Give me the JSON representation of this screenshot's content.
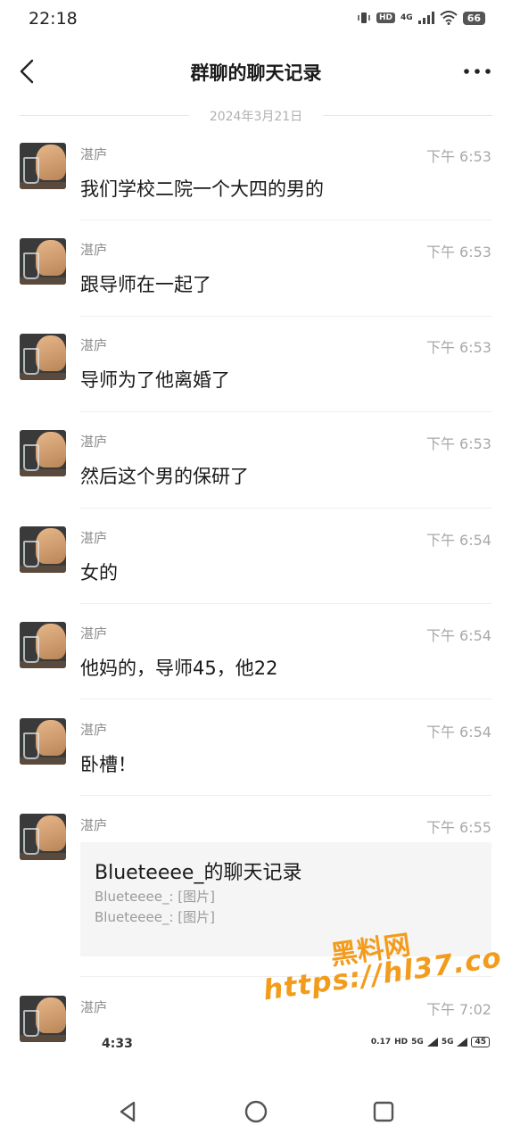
{
  "status_bar": {
    "time": "22:18",
    "hd": "HD",
    "network": "4G",
    "battery": "66"
  },
  "header": {
    "title": "群聊的聊天记录"
  },
  "date_separator": "2024年3月21日",
  "messages": [
    {
      "sender": "湛庐",
      "time": "下午 6:53",
      "text": "我们学校二院一个大四的男的"
    },
    {
      "sender": "湛庐",
      "time": "下午 6:53",
      "text": "跟导师在一起了"
    },
    {
      "sender": "湛庐",
      "time": "下午 6:53",
      "text": "导师为了他离婚了"
    },
    {
      "sender": "湛庐",
      "time": "下午 6:53",
      "text": "然后这个男的保研了"
    },
    {
      "sender": "湛庐",
      "time": "下午 6:54",
      "text": "女的"
    },
    {
      "sender": "湛庐",
      "time": "下午 6:54",
      "text": "他妈的，导师45，他22"
    },
    {
      "sender": "湛庐",
      "time": "下午 6:54",
      "text": "卧槽！"
    }
  ],
  "record_message": {
    "sender": "湛庐",
    "time": "下午 6:55",
    "card_title": "Blueteeee_的聊天记录",
    "lines": [
      "Blueteeee_: [图片]",
      "Blueteeee_: [图片]"
    ]
  },
  "last_message": {
    "sender": "湛庐",
    "time": "下午 7:02"
  },
  "nested_screenshot": {
    "time": "4:33",
    "speed": "0.17",
    "hd": "HD",
    "net1": "5G",
    "net2": "5G",
    "battery": "45"
  },
  "watermark": {
    "top": "黑料网",
    "url": "https://hl37.co"
  }
}
